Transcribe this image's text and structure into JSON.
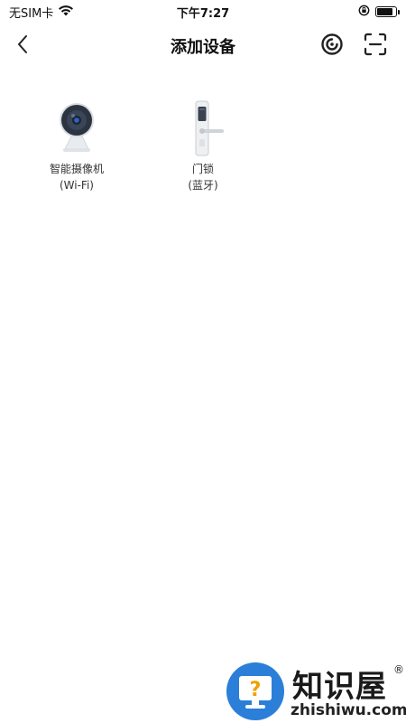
{
  "status_bar": {
    "carrier": "无SIM卡",
    "time": "下午7:27",
    "battery_level": 0.85,
    "icons": [
      "wifi-icon",
      "orientation-lock-icon",
      "battery-icon"
    ]
  },
  "nav": {
    "title": "添加设备",
    "icons": [
      "back-chevron-icon",
      "nearby-scan-icon",
      "qr-scan-icon"
    ]
  },
  "devices": [
    {
      "name": "智能摄像机",
      "sub": "(Wi-Fi)",
      "icon": "smart-camera-icon"
    },
    {
      "name": "门锁",
      "sub": "(蓝牙)",
      "icon": "door-lock-icon"
    }
  ],
  "watermark": {
    "text": "知识屋",
    "mark": "®",
    "url": "zhishiwu.com",
    "colors": {
      "circle": "#2b7fd8",
      "screen": "#ffffff",
      "question": "#f0a000"
    }
  }
}
